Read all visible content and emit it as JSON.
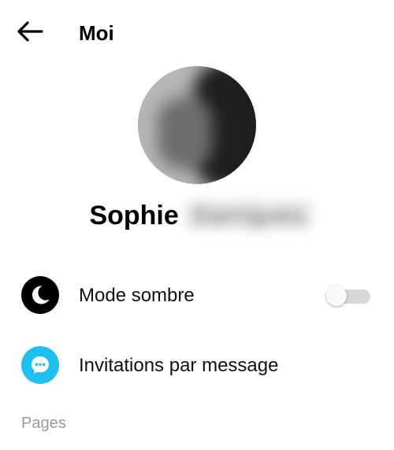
{
  "header": {
    "title": "Moi",
    "back_icon": "arrow-left-icon"
  },
  "profile": {
    "first_name": "Sophie",
    "last_name_redacted": "Garrigues",
    "avatar_icon": "profile-photo"
  },
  "settings": [
    {
      "label": "Mode sombre",
      "icon": "moon-icon",
      "icon_bg": "#000000",
      "toggle": false
    },
    {
      "label": "Invitations par message",
      "icon": "chat-bubble-icon",
      "icon_bg": "#1ec0f2"
    }
  ],
  "sections": {
    "pages_label": "Pages"
  },
  "colors": {
    "toggle_track": "#d8d8d8",
    "section_label": "#9a9a9a"
  }
}
